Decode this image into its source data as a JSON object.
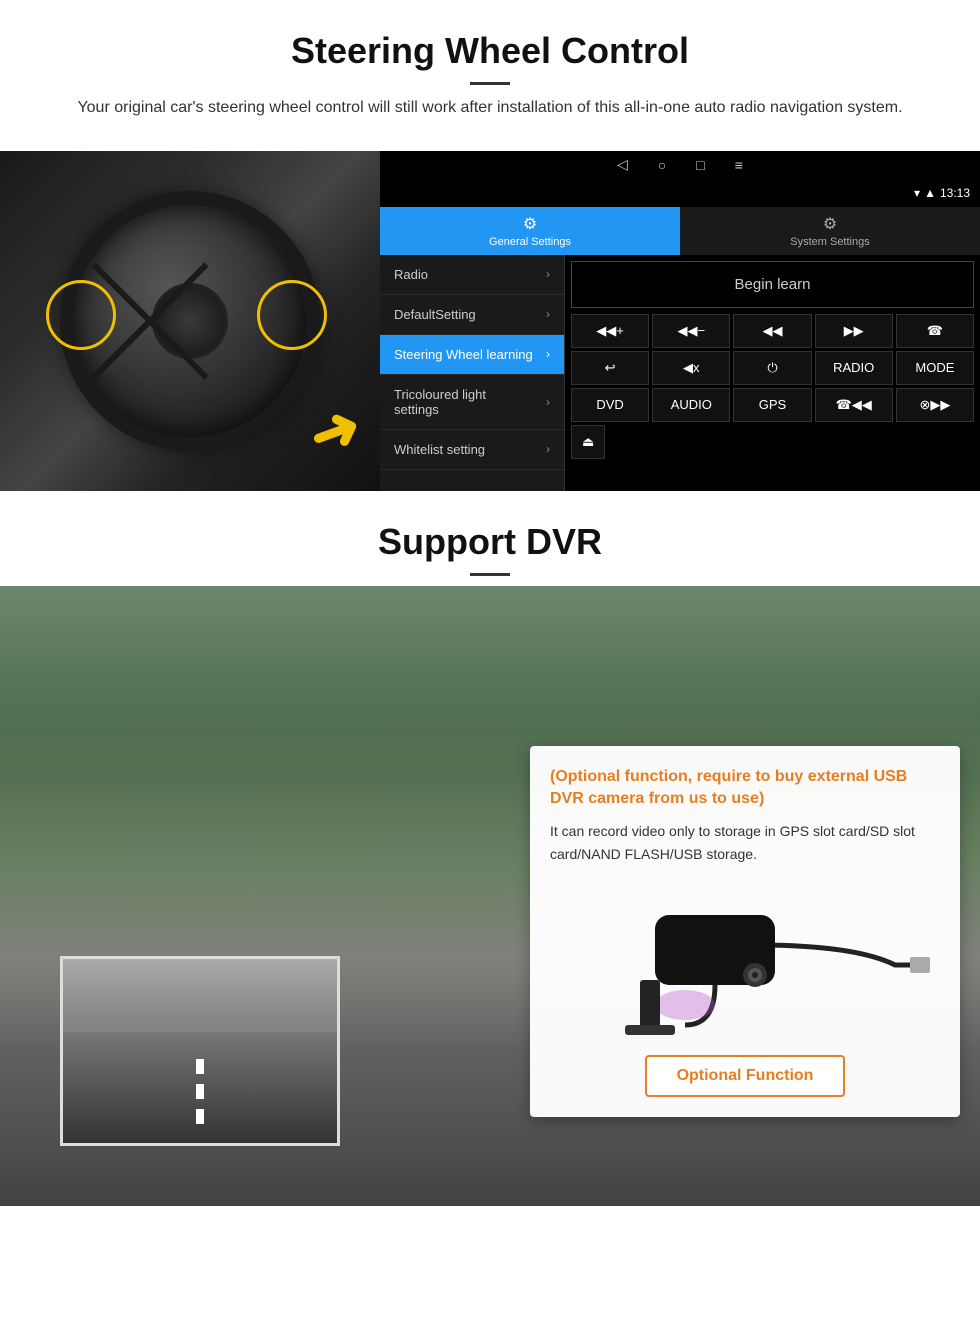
{
  "section1": {
    "title": "Steering Wheel Control",
    "subtitle": "Your original car's steering wheel control will still work after installation of this all-in-one auto radio navigation system.",
    "android": {
      "statusBar": {
        "time": "13:13",
        "wifiIcon": "▾",
        "signalIcon": "▲"
      },
      "navBar": {
        "backBtn": "◁",
        "homeBtn": "○",
        "recentBtn": "□",
        "menuBtn": "≡"
      },
      "tabs": [
        {
          "label": "General Settings",
          "active": true,
          "icon": "⚙"
        },
        {
          "label": "System Settings",
          "active": false,
          "icon": "⚙"
        }
      ],
      "menuItems": [
        {
          "label": "Radio",
          "highlighted": false
        },
        {
          "label": "DefaultSetting",
          "highlighted": false
        },
        {
          "label": "Steering Wheel learning",
          "highlighted": true
        },
        {
          "label": "Tricoloured light settings",
          "highlighted": false
        },
        {
          "label": "Whitelist setting",
          "highlighted": false
        }
      ],
      "beginLearnBtn": "Begin learn",
      "controlRow1": [
        "◀◀+",
        "◀◀−",
        "◀◀",
        "▶▶",
        "☎"
      ],
      "controlRow2": [
        "↩",
        "◀x",
        "⏻",
        "RADIO",
        "MODE"
      ],
      "controlRow3": [
        "DVD",
        "AUDIO",
        "GPS",
        "☎◀◀",
        "⊗▶▶"
      ],
      "controlRow4": [
        "⏏"
      ]
    }
  },
  "section2": {
    "title": "Support DVR",
    "card": {
      "titleText": "(Optional function, require to buy external USB DVR camera from us to use)",
      "bodyText": "It can record video only to storage in GPS slot card/SD slot card/NAND FLASH/USB storage.",
      "buttonLabel": "Optional Function"
    }
  }
}
